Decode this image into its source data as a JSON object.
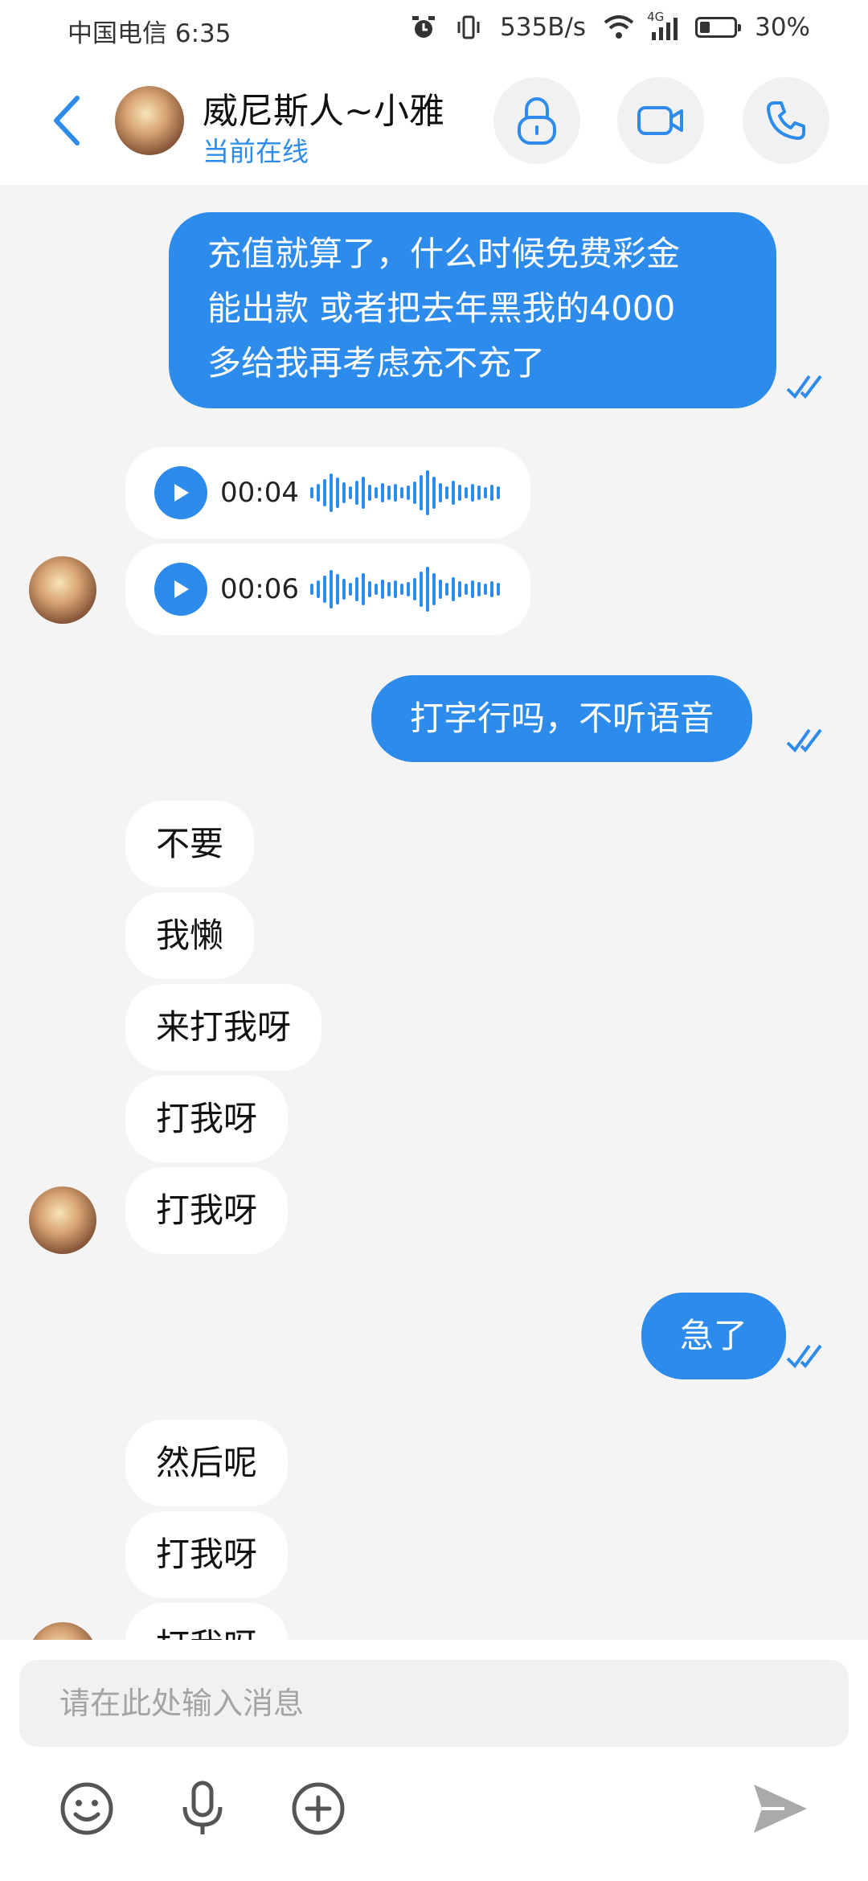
{
  "status_bar": {
    "carrier_time": "中国电信 6:35",
    "speed": "535B/s",
    "net": "4G",
    "battery": "30%",
    "battery_level": 0.3
  },
  "header": {
    "contact_name": "威尼斯人~小雅",
    "presence": "当前在线",
    "icons": [
      "back-arrow-icon",
      "lock-icon",
      "video-camera-icon",
      "phone-icon"
    ]
  },
  "messages": {
    "m1": "充值就算了，什么时候免费彩金能出款 或者把去年黑我的4000多给我再考虑充不充了",
    "m1_lines": [
      "充值就算了，什么时候免费彩金",
      "能出款 或者把去年黑我的4000",
      "多给我再考虑充不充了"
    ],
    "voice1": "00:04",
    "voice2": "00:06",
    "m2": "打字行吗，不听语音",
    "m3": "不要",
    "m4": "我懒",
    "m5": "来打我呀",
    "m6": "打我呀",
    "m7": "打我呀",
    "m8": "急了",
    "m9": "然后呢",
    "m10": "打我呀",
    "m11": "打我呀"
  },
  "input": {
    "placeholder": "请在此处输入消息",
    "icons": [
      "emoji-icon",
      "microphone-icon",
      "add-icon",
      "send-icon"
    ]
  },
  "colors": {
    "accent": "#2d8ceb",
    "chat_bg": "#f4f4f4"
  }
}
